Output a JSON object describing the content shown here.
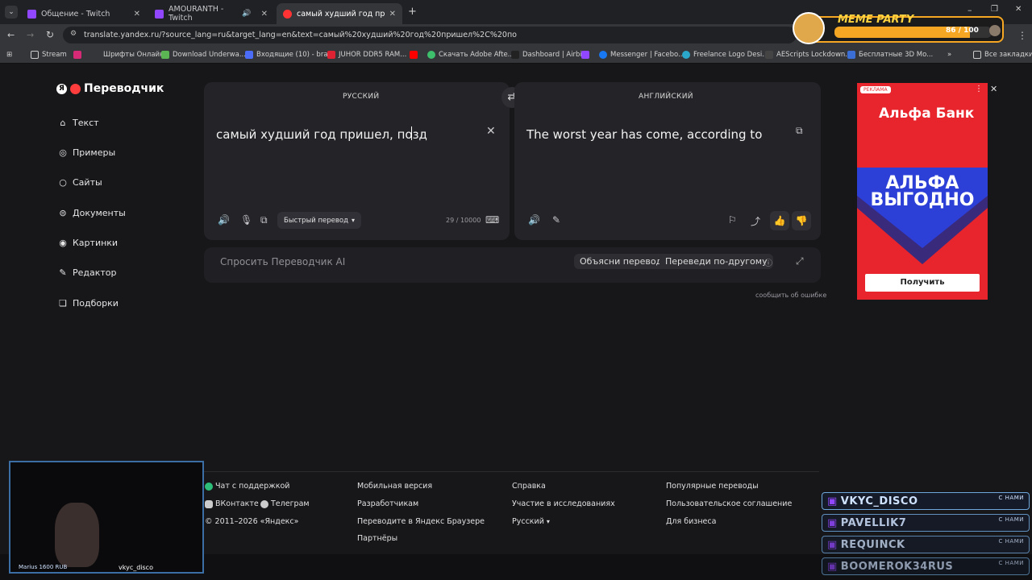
{
  "browser": {
    "tabs": [
      {
        "label": "Общение - Twitch",
        "active": false
      },
      {
        "label": "AMOURANTH - Twitch",
        "active": false
      },
      {
        "label": "самый худший год пришел, по",
        "active": true
      }
    ],
    "url": "translate.yandex.ru/?source_lang=ru&target_lang=en&text=самый%20худший%20год%20пришел%2C%20по",
    "bookmarks": [
      "Stream",
      "Шрифты Онлайн",
      "Download Underwa...",
      "Входящие (10) - bra...",
      "JUHOR DDR5 RAM...",
      "Скачать Adobe Afte...",
      "Dashboard | Airbit",
      "Messenger | Facebo...",
      "Freelance Logo Desi...",
      "AEScripts Lockdown...",
      "Бесплатные 3D Mo..."
    ],
    "all_bookmarks": "Все закладки"
  },
  "app": {
    "logo": "Переводчик",
    "nav": [
      {
        "label": "Текст",
        "icon": "home-icon"
      },
      {
        "label": "Примеры",
        "icon": "examples-icon"
      },
      {
        "label": "Сайты",
        "icon": "sites-icon"
      },
      {
        "label": "Документы",
        "icon": "documents-icon"
      },
      {
        "label": "Картинки",
        "icon": "images-icon"
      },
      {
        "label": "Редактор",
        "icon": "editor-icon"
      },
      {
        "label": "Подборки",
        "icon": "collections-icon"
      }
    ]
  },
  "translator": {
    "source_lang": "РУССКИЙ",
    "target_lang": "АНГЛИЙСКИЙ",
    "source_text": "самый худший год пришел, позд",
    "target_text": "The worst year has come, according to",
    "mode": "Быстрый перевод",
    "char_count": "29 / 10000"
  },
  "ai": {
    "placeholder": "Спросить Переводчик AI",
    "chip1": "Объясни перевод",
    "chip2": "Переведи по-другому"
  },
  "report_error": "сообщить об ошибке",
  "ad": {
    "tag": "РЕКЛАМА",
    "brand": "Альфа Банк",
    "headline1": "АЛЬФА",
    "headline2": "ВЫГОДНО",
    "button": "Получить"
  },
  "footer": {
    "col1": [
      "Чат с поддержкой",
      "ВКонтакте",
      "Телеграм",
      "© 2011–2026 «Яндекс»"
    ],
    "col2": [
      "Мобильная версия",
      "Разработчикам",
      "Переводите в Яндекс Браузере",
      "Партнёры"
    ],
    "col3": [
      "Справка",
      "Участие в исследованиях",
      "Русский"
    ],
    "col4": [
      "Популярные переводы",
      "Пользовательское соглашение",
      "Для бизнеса"
    ]
  },
  "overlay": {
    "meme_title": "MEME PARTY",
    "meme_progress": "86 / 100",
    "meme_fraction": 0.86,
    "chatters": [
      "VKYC_DISCO",
      "PAVELLIK7",
      "REQUINCK",
      "BOOMEROK34RUS"
    ],
    "chatter_sub": "С НАМИ",
    "cam_caption_left": "Marius 1600 RUB",
    "cam_caption_right": "vkyc_disco"
  }
}
